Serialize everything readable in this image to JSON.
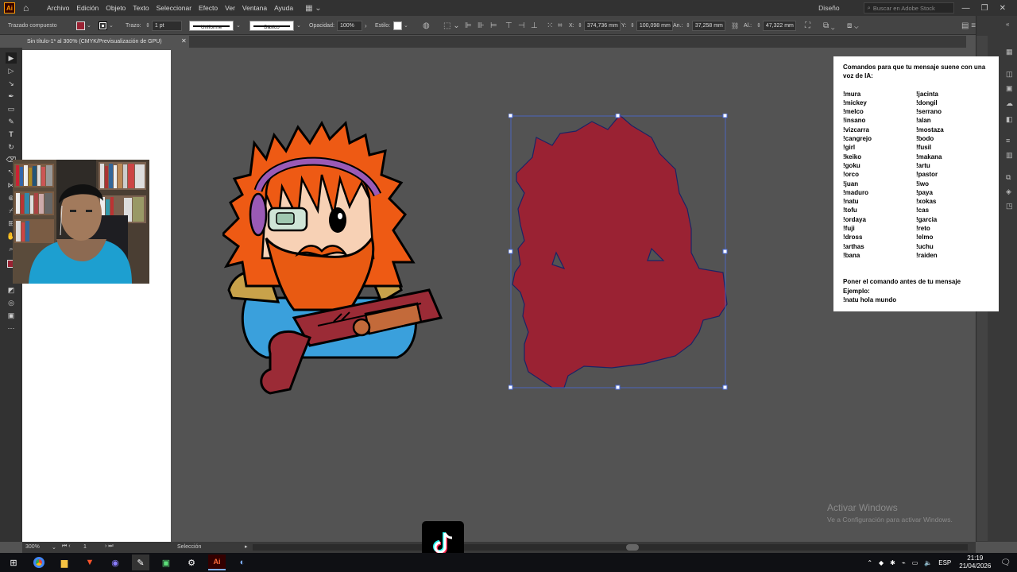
{
  "app": {
    "logo_text": "Ai",
    "menu": [
      "Archivo",
      "Edición",
      "Objeto",
      "Texto",
      "Seleccionar",
      "Efecto",
      "Ver",
      "Ventana",
      "Ayuda"
    ],
    "workspace": "Diseño",
    "stock_placeholder": "Buscar en Adobe Stock"
  },
  "control": {
    "object_type": "Trazado compuesto",
    "fill_color": "#9a2233",
    "stroke_label": "Trazo:",
    "stroke_weight": "1 pt",
    "profile_label": "Uniforme",
    "brush_label": "Básico",
    "opacity_label": "Opacidad:",
    "opacity_value": "100%",
    "style_label": "Estilo:",
    "x_label": "X:",
    "x_value": "374,736 mm",
    "y_label": "Y:",
    "y_value": "100,098 mm",
    "w_label": "An.:",
    "w_value": "37,258 mm",
    "h_label": "Al.:",
    "h_value": "47,322 mm"
  },
  "document": {
    "tab_title": "Sin título-1* al 300% (CMYK/Previsualización de GPU)"
  },
  "status": {
    "zoom": "300%",
    "artboard_num": "1",
    "tool": "Selección"
  },
  "panel": {
    "title": "Comandos para que tu mensaje suene con una voz de IA:",
    "commands_left": [
      "!mura",
      "!mickey",
      "!melco",
      "!insano",
      "!vizcarra",
      "!cangrejo",
      "!girl",
      "!keiko",
      "!goku",
      "!orco",
      "!juan",
      "!maduro",
      "!natu",
      "!tofu",
      "!ordaya",
      "!fuji",
      "!dross",
      "!arthas",
      "!bana"
    ],
    "commands_right": [
      "!jacinta",
      "!dongil",
      "!serrano",
      "!alan",
      "!mostaza",
      "!bodo",
      "!fusil",
      "!makana",
      "!artu",
      "!pastor",
      "!iwo",
      "!paya",
      "!xokas",
      "!cas",
      "!garcia",
      "!reto",
      "!elmo",
      "!uchu",
      "!raiden"
    ],
    "footer1": "Poner el comando antes de tu mensaje",
    "footer2": "Ejemplo:",
    "footer3": "!natu hola mundo"
  },
  "watermark": {
    "line1": "Activar Windows",
    "line2": "Ve a Configuración para activar Windows."
  },
  "taskbar": {
    "lang": "ESP",
    "time": "21:19",
    "date": "21/04/2026"
  },
  "colors": {
    "silhouette": "#9a2233",
    "hair": "#ee5a14",
    "beard": "#e85a12",
    "gun": "#9b2b36",
    "shirt": "#3aa0dc",
    "skin": "#f7d1b5"
  }
}
